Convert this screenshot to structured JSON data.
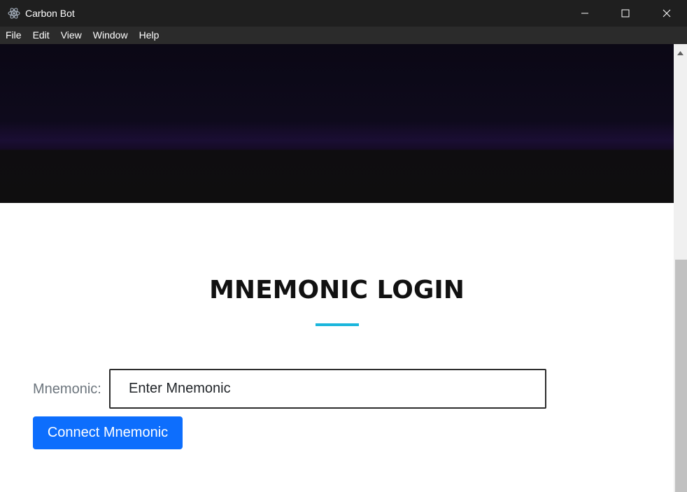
{
  "window": {
    "title": "Carbon Bot",
    "icon": "electron-atom-icon",
    "controls": [
      "minimize-icon",
      "maximize-icon",
      "close-icon"
    ]
  },
  "menu": {
    "items": [
      "File",
      "Edit",
      "View",
      "Window",
      "Help"
    ]
  },
  "login": {
    "title": "MNEMONIC LOGIN",
    "field_label": "Mnemonic:",
    "input_placeholder": "Enter Mnemonic",
    "input_value": "",
    "submit_label": "Connect Mnemonic"
  },
  "colors": {
    "accent_underline": "#1bb6dc",
    "button": "#0d6efd",
    "titlebar": "#1f1f1f",
    "menubar": "#2b2b2b",
    "hero_band": "#1a0e33"
  }
}
